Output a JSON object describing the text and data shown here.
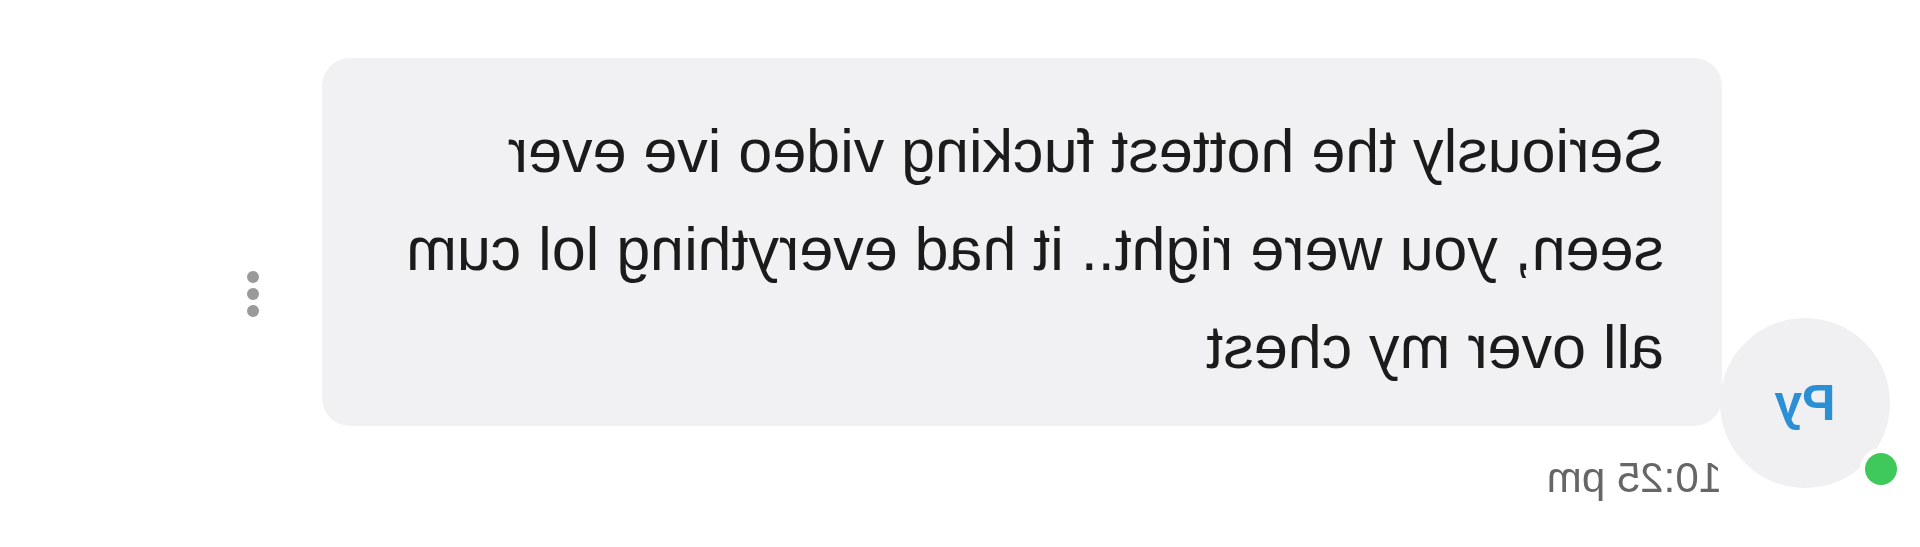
{
  "message": {
    "avatar_initials": "Py",
    "online": true,
    "text": "Seriously the hottest fucking video ive ever seen, you were right.. it had everything lol cum all over my chest",
    "time": "10:25 pm"
  }
}
